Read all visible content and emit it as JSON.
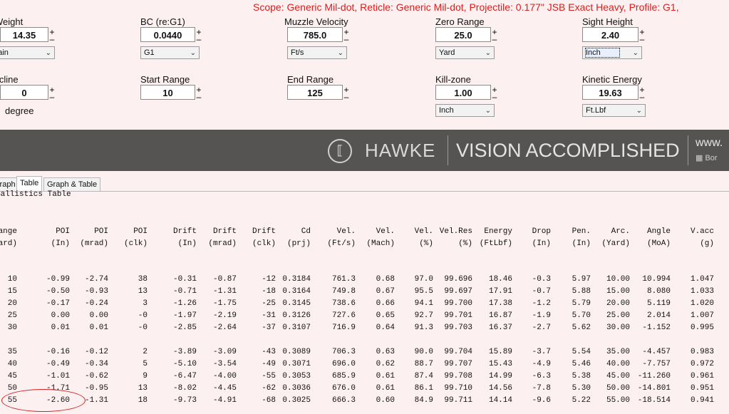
{
  "scope_line": "Scope: Generic Mil-dot, Reticle: Generic Mil-dot, Projectile: 0.177\" JSB Exact Heavy, Profile: G1,",
  "inputs": {
    "weight": {
      "label": "Weight",
      "value": "14.35",
      "unit": "Grain"
    },
    "bc": {
      "label": "BC (re:G1)",
      "value": "0.0440",
      "unit": "G1"
    },
    "muzzle_velocity": {
      "label": "Muzzle Velocity",
      "value": "785.0",
      "unit": "Ft/s"
    },
    "zero_range": {
      "label": "Zero Range",
      "value": "25.0",
      "unit": "Yard"
    },
    "sight_height": {
      "label": "Sight Height",
      "value": "2.40",
      "unit": "Inch"
    },
    "incline": {
      "label": "Incline",
      "value": "0",
      "unit": "degree"
    },
    "start_range": {
      "label": "Start Range",
      "value": "10"
    },
    "end_range": {
      "label": "End Range",
      "value": "125"
    },
    "kill_zone": {
      "label": "Kill-zone",
      "value": "1.00",
      "unit": "Inch"
    },
    "kinetic_energy": {
      "label": "Kinetic Energy",
      "value": "19.63",
      "unit": "Ft.Lbf"
    },
    "plus": "+",
    "minus": "–"
  },
  "banner": {
    "brand": "HAWKE",
    "tagline": "VISION ACCOMPLISHED",
    "site": "www.",
    "flag_text": "Bor"
  },
  "tabs": [
    "Graph",
    "Table",
    "Graph & Table"
  ],
  "active_tab": "Table",
  "table": {
    "title": "Ballistics Table",
    "headers1": [
      "Range",
      "POI",
      "POI",
      "POI",
      "Drift",
      "Drift",
      "Drift",
      "Cd",
      "Vel.",
      "Vel.",
      "Vel.",
      "Vel.Res",
      "Energy",
      "Drop",
      "Pen.",
      "Arc.",
      "Angle",
      "V.acc"
    ],
    "headers2": [
      "(Yard)",
      "(In)",
      "(mrad)",
      "(clk)",
      "(In)",
      "(mrad)",
      "(clk)",
      "(prj)",
      "(Ft/s)",
      "(Mach)",
      "(%)",
      "(%)",
      "(FtLbf)",
      "(In)",
      "(In)",
      "(Yard)",
      "(MoA)",
      "(g)"
    ],
    "rows": [
      [
        "10",
        "-0.99",
        "-2.74",
        "38",
        "-0.31",
        "-0.87",
        "-12",
        "0.3184",
        "761.3",
        "0.68",
        "97.0",
        "99.696",
        "18.46",
        "-0.3",
        "5.97",
        "10.00",
        "10.994",
        "1.047"
      ],
      [
        "15",
        "-0.50",
        "-0.93",
        "13",
        "-0.71",
        "-1.31",
        "-18",
        "0.3164",
        "749.8",
        "0.67",
        "95.5",
        "99.697",
        "17.91",
        "-0.7",
        "5.88",
        "15.00",
        "8.080",
        "1.033"
      ],
      [
        "20",
        "-0.17",
        "-0.24",
        "3",
        "-1.26",
        "-1.75",
        "-25",
        "0.3145",
        "738.6",
        "0.66",
        "94.1",
        "99.700",
        "17.38",
        "-1.2",
        "5.79",
        "20.00",
        "5.119",
        "1.020"
      ],
      [
        "25",
        "0.00",
        "0.00",
        "-0",
        "-1.97",
        "-2.19",
        "-31",
        "0.3126",
        "727.6",
        "0.65",
        "92.7",
        "99.701",
        "16.87",
        "-1.9",
        "5.70",
        "25.00",
        "2.014",
        "1.007"
      ],
      [
        "30",
        "0.01",
        "0.01",
        "-0",
        "-2.85",
        "-2.64",
        "-37",
        "0.3107",
        "716.9",
        "0.64",
        "91.3",
        "99.703",
        "16.37",
        "-2.7",
        "5.62",
        "30.00",
        "-1.152",
        "0.995"
      ],
      [
        "35",
        "-0.16",
        "-0.12",
        "2",
        "-3.89",
        "-3.09",
        "-43",
        "0.3089",
        "706.3",
        "0.63",
        "90.0",
        "99.704",
        "15.89",
        "-3.7",
        "5.54",
        "35.00",
        "-4.457",
        "0.983"
      ],
      [
        "40",
        "-0.49",
        "-0.34",
        "5",
        "-5.10",
        "-3.54",
        "-49",
        "0.3071",
        "696.0",
        "0.62",
        "88.7",
        "99.707",
        "15.43",
        "-4.9",
        "5.46",
        "40.00",
        "-7.757",
        "0.972"
      ],
      [
        "45",
        "-1.01",
        "-0.62",
        "9",
        "-6.47",
        "-4.00",
        "-55",
        "0.3053",
        "685.9",
        "0.61",
        "87.4",
        "99.708",
        "14.99",
        "-6.3",
        "5.38",
        "45.00",
        "-11.260",
        "0.961"
      ],
      [
        "50",
        "-1.71",
        "-0.95",
        "13",
        "-8.02",
        "-4.45",
        "-62",
        "0.3036",
        "676.0",
        "0.61",
        "86.1",
        "99.710",
        "14.56",
        "-7.8",
        "5.30",
        "50.00",
        "-14.801",
        "0.951"
      ],
      [
        "55",
        "-2.60",
        "-1.31",
        "18",
        "-9.73",
        "-4.91",
        "-68",
        "0.3025",
        "666.3",
        "0.60",
        "84.9",
        "99.711",
        "14.14",
        "-9.6",
        "5.22",
        "55.00",
        "-18.514",
        "0.941"
      ]
    ]
  }
}
